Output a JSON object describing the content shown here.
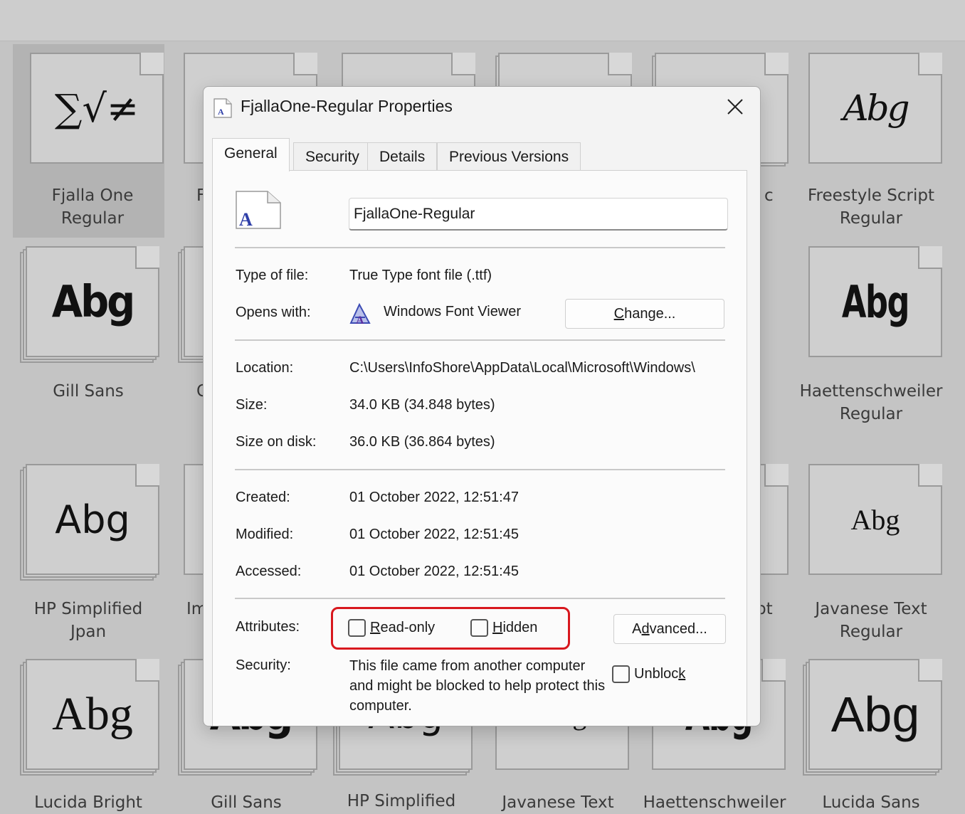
{
  "background_tiles": [
    {
      "name": "Fjalla One Regular",
      "line1": "Fjalla One",
      "line2": "Regular",
      "sample": "∑√≠"
    },
    {
      "name": "Freestyle Script Regular",
      "line1": "Freestyle Script",
      "line2": "Regular",
      "sample": "Abg"
    },
    {
      "name": "Gill Sans",
      "line1": "Gill Sans",
      "line2": "",
      "sample": "Abg"
    },
    {
      "name": "Haettenschweiler Regular",
      "line1": "Haettenschweiler",
      "line2": "Regular",
      "sample": "Abg"
    },
    {
      "name": "HP Simplified Jpan",
      "line1": "HP Simplified",
      "line2": "Jpan",
      "sample": "Abg"
    },
    {
      "name": "Javanese Text Regular",
      "line1": "Javanese Text",
      "line2": "Regular",
      "sample": "Abg"
    },
    {
      "name": "Lucida Bright",
      "line1": "Lucida Bright",
      "line2": "",
      "sample": "Abg"
    },
    {
      "name": "Gill Sans",
      "line1": "Gill Sans",
      "line2": "",
      "sample": "Abg"
    },
    {
      "name": "HP Simplified",
      "line1": "HP Simplified",
      "line2": "",
      "sample": "Abg"
    },
    {
      "name": "Javanese Text",
      "line1": "Javanese Text",
      "line2": "",
      "sample": "Abg"
    },
    {
      "name": "Haettenschweiler",
      "line1": "Haettenschweiler",
      "line2": "",
      "sample": "Abg"
    },
    {
      "name": "Lucida Sans",
      "line1": "Lucida Sans",
      "line2": "",
      "sample": "Abg"
    }
  ],
  "partial_labels": {
    "f": "F",
    "g": "G",
    "im": "Im",
    "c": "c",
    "pt": "pt"
  },
  "dialog": {
    "title": "FjallaOne-Regular Properties",
    "close_glyph": "✕",
    "tabs": [
      "General",
      "Security",
      "Details",
      "Previous Versions"
    ],
    "active_tab": "General",
    "file_name": "FjallaOne-Regular",
    "file_icon_letter": "A",
    "type_label": "Type of file:",
    "type_value": "True Type font file (.ttf)",
    "opens_label": "Opens with:",
    "opens_value": "Windows Font Viewer",
    "change_button": {
      "prefix": "",
      "underlined": "C",
      "suffix": "hange..."
    },
    "location_label": "Location:",
    "location_value": "C:\\Users\\InfoShore\\AppData\\Local\\Microsoft\\Windows\\",
    "size_label": "Size:",
    "size_value": "34.0 KB (34.848 bytes)",
    "size_on_disk_label": "Size on disk:",
    "size_on_disk_value": "36.0 KB (36.864 bytes)",
    "created_label": "Created:",
    "created_value": "01 October 2022, 12:51:47",
    "modified_label": "Modified:",
    "modified_value": "01 October 2022, 12:51:45",
    "accessed_label": "Accessed:",
    "accessed_value": "01 October 2022, 12:51:45",
    "attributes_label": "Attributes:",
    "readonly": {
      "underlined": "R",
      "suffix": "ead-only",
      "checked": false
    },
    "hidden": {
      "underlined": "H",
      "suffix": "idden",
      "checked": false
    },
    "advanced_button": {
      "prefix": "A",
      "underlined": "d",
      "suffix": "vanced..."
    },
    "security_label": "Security:",
    "security_text": "This file came from another computer and might be blocked to help protect this computer.",
    "unblock": {
      "prefix": "Unbloc",
      "underlined": "k",
      "suffix": "",
      "checked": false
    }
  }
}
